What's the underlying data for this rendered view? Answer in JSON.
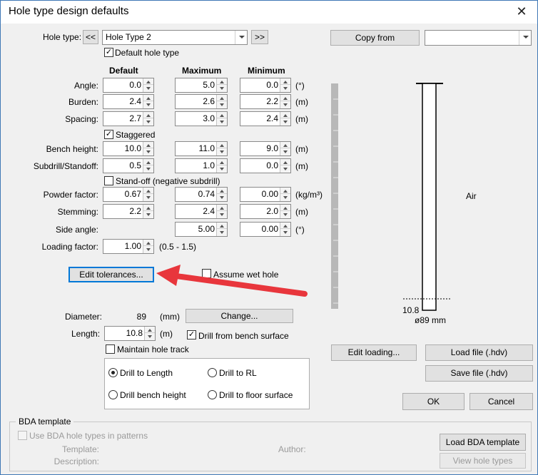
{
  "window": {
    "title": "Hole type design defaults",
    "close_icon": "✕"
  },
  "hole_type": {
    "label": "Hole type:",
    "prev_label": "<<",
    "next_label": ">>",
    "value": "Hole Type 2",
    "default_label": "Default hole type",
    "default_checked": true
  },
  "headers": {
    "default": "Default",
    "maximum": "Maximum",
    "minimum": "Minimum"
  },
  "params": [
    {
      "label": "Angle:",
      "default": "0.0",
      "maximum": "5.0",
      "minimum": "0.0",
      "unit": "(°)"
    },
    {
      "label": "Burden:",
      "default": "2.4",
      "maximum": "2.6",
      "minimum": "2.2",
      "unit": "(m)"
    },
    {
      "label": "Spacing:",
      "default": "2.7",
      "maximum": "3.0",
      "minimum": "2.4",
      "unit": "(m)"
    },
    {
      "label": "Bench height:",
      "default": "10.0",
      "maximum": "11.0",
      "minimum": "9.0",
      "unit": "(m)"
    },
    {
      "label": "Subdrill/Standoff:",
      "default": "0.5",
      "maximum": "1.0",
      "minimum": "0.0",
      "unit": "(m)"
    },
    {
      "label": "Powder factor:",
      "default": "0.67",
      "maximum": "0.74",
      "minimum": "0.00",
      "unit": "(kg/m³)"
    },
    {
      "label": "Stemming:",
      "default": "2.2",
      "maximum": "2.4",
      "minimum": "2.0",
      "unit": "(m)"
    },
    {
      "label": "Side angle:",
      "default": "",
      "maximum": "5.00",
      "minimum": "0.00",
      "unit": "(°)"
    }
  ],
  "staggered": {
    "label": "Staggered",
    "checked": true
  },
  "standoff": {
    "label": "Stand-off (negative subdrill)",
    "checked": false
  },
  "loading_factor": {
    "label": "Loading factor:",
    "value": "1.00",
    "range": "(0.5 - 1.5)"
  },
  "edit_tolerances_label": "Edit tolerances...",
  "assume_wet": {
    "label": "Assume wet hole",
    "checked": false
  },
  "diameter": {
    "label": "Diameter:",
    "value": "89",
    "unit": "(mm)",
    "change_label": "Change..."
  },
  "length": {
    "label": "Length:",
    "value": "10.8",
    "unit": "(m)"
  },
  "drill_from_bench": {
    "label": "Drill from bench surface",
    "checked": true
  },
  "maintain_track": {
    "label": "Maintain hole track",
    "checked": false
  },
  "drill_options": [
    {
      "label": "Drill to Length",
      "selected": true
    },
    {
      "label": "Drill to RL",
      "selected": false
    },
    {
      "label": "Drill bench height",
      "selected": false
    },
    {
      "label": "Drill to floor surface",
      "selected": false
    }
  ],
  "copy_from": {
    "label": "Copy from",
    "value": ""
  },
  "diagram": {
    "air_label": "Air",
    "depth_label": "10.8",
    "diameter_label": "ø89 mm"
  },
  "buttons": {
    "edit_loading": "Edit loading...",
    "load_file": "Load file (.hdv)",
    "save_file": "Save file (.hdv)",
    "ok": "OK",
    "cancel": "Cancel"
  },
  "bda": {
    "group_title": "BDA template",
    "use_label": "Use BDA hole types in patterns",
    "template_label": "Template:",
    "author_label": "Author:",
    "description_label": "Description:",
    "load_button": "Load BDA template",
    "view_button": "View hole types"
  },
  "annotation": {
    "arrow_color": "#e8363c"
  }
}
